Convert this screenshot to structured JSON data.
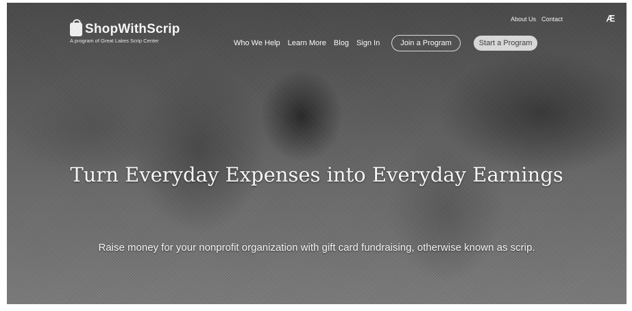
{
  "brand": {
    "name": "ShopWithScrip",
    "tagline": "A program of Great Lakes Scrip Center"
  },
  "utility_links": [
    "About Us",
    "Contact"
  ],
  "nav": {
    "items": [
      "Who We Help",
      "Learn More",
      "Blog",
      "Sign In"
    ],
    "join_button": "Join a Program",
    "start_button": "Start a Program"
  },
  "hero": {
    "title": "Turn Everyday Expenses into Everyday Earnings",
    "subtitle": "Raise money for your nonprofit organization with gift card fundraising, otherwise known as scrip."
  },
  "icons": {
    "corner": "hubspot-icon",
    "logo": "shopping-bag-icon"
  }
}
